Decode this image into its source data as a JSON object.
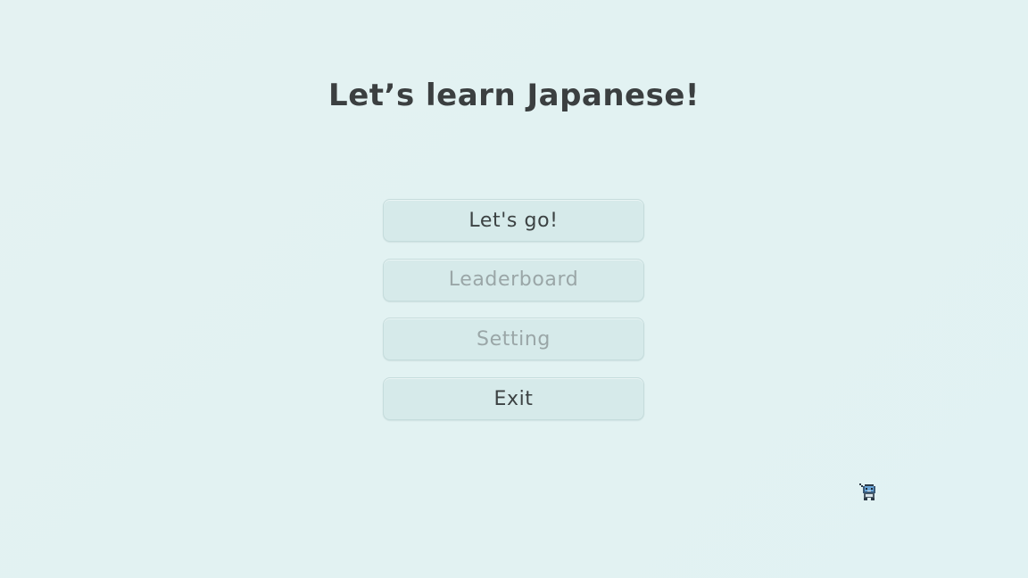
{
  "title": "Let’s learn Japanese!",
  "menu": {
    "buttons": [
      {
        "label": "Let's go!",
        "enabled": true
      },
      {
        "label": "Leaderboard",
        "enabled": false
      },
      {
        "label": "Setting",
        "enabled": false
      },
      {
        "label": "Exit",
        "enabled": true
      }
    ]
  },
  "colors": {
    "background": "#e2f2f2",
    "title": "#3b3f40",
    "button_bg": "#d6eaea",
    "button_text": "#3c4243",
    "button_text_disabled": "#9aa6a7"
  },
  "icons": {
    "mascot": "pixel-character-icon"
  }
}
